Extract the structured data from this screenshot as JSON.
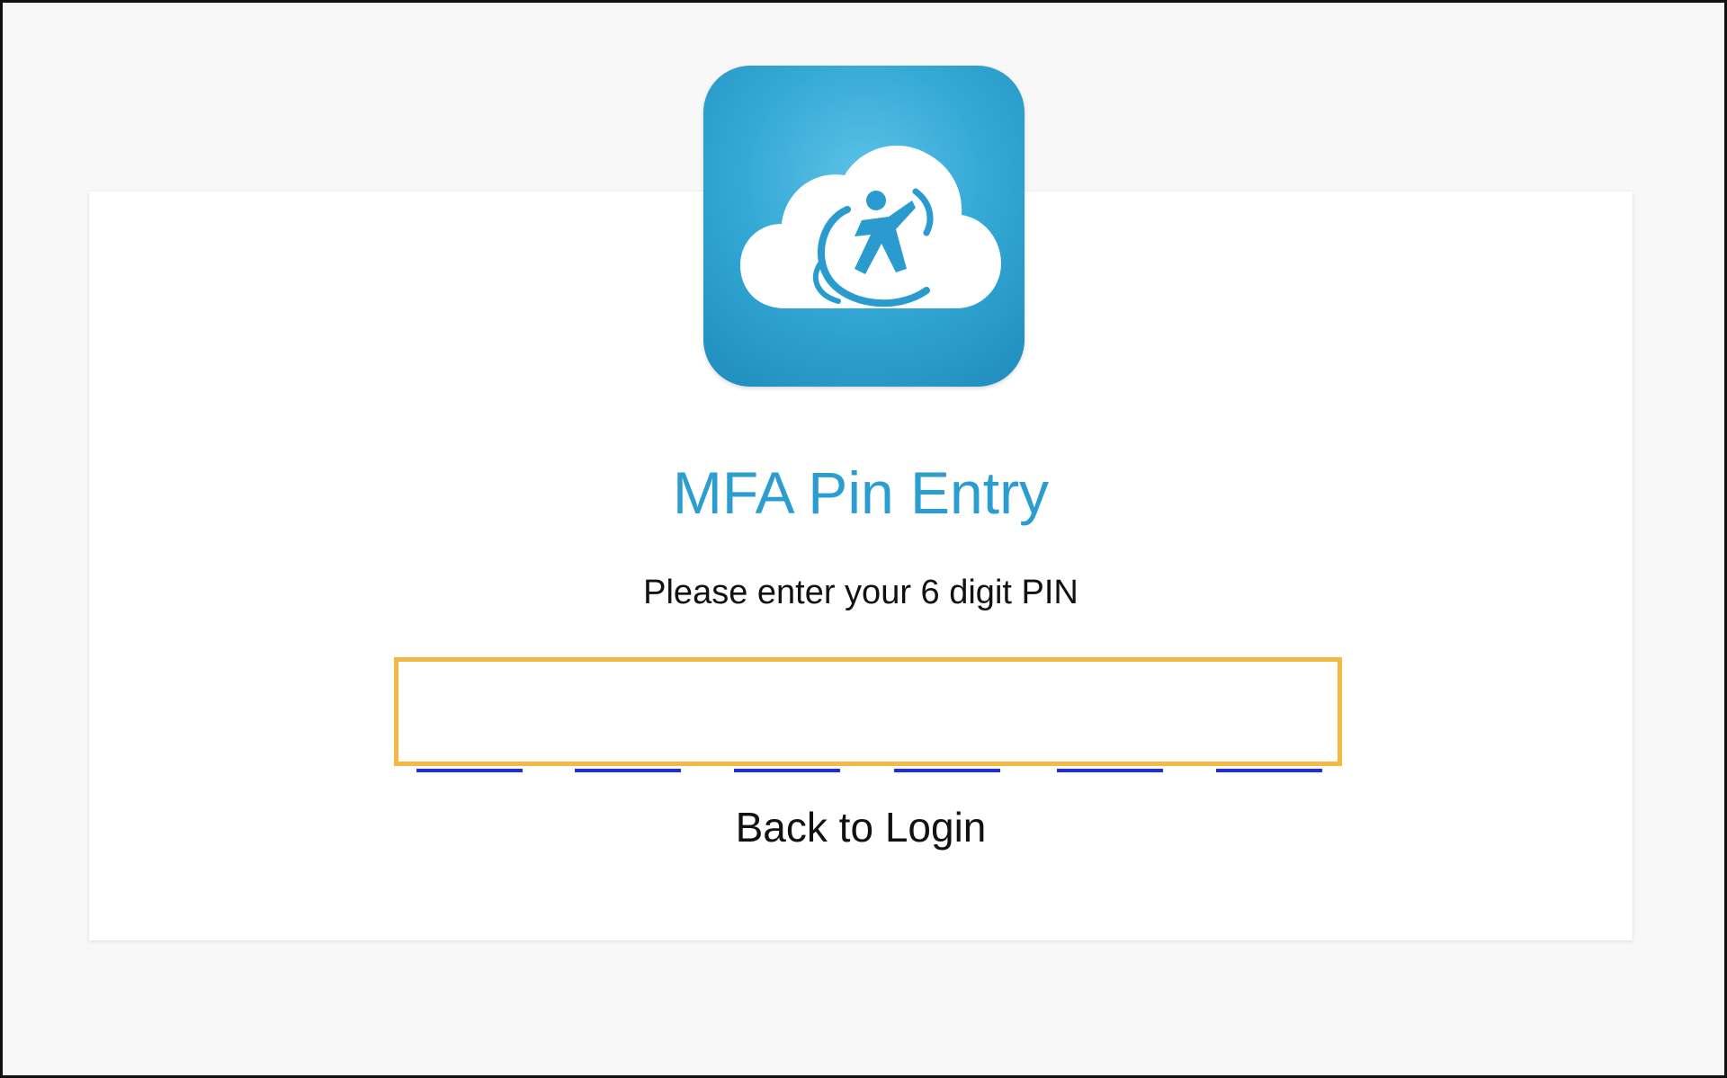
{
  "title": "MFA Pin Entry",
  "instruction": "Please enter your 6 digit PIN",
  "pin": {
    "digit_count": 6,
    "values": [
      "",
      "",
      "",
      "",
      "",
      ""
    ]
  },
  "back_link": "Back to Login",
  "logo": {
    "icon": "cloud-person-icon"
  },
  "colors": {
    "accent": "#2b9dd0",
    "pin_underline": "#1e2cf0",
    "highlight_border": "#f5b840",
    "background": "#f8f8f8"
  }
}
